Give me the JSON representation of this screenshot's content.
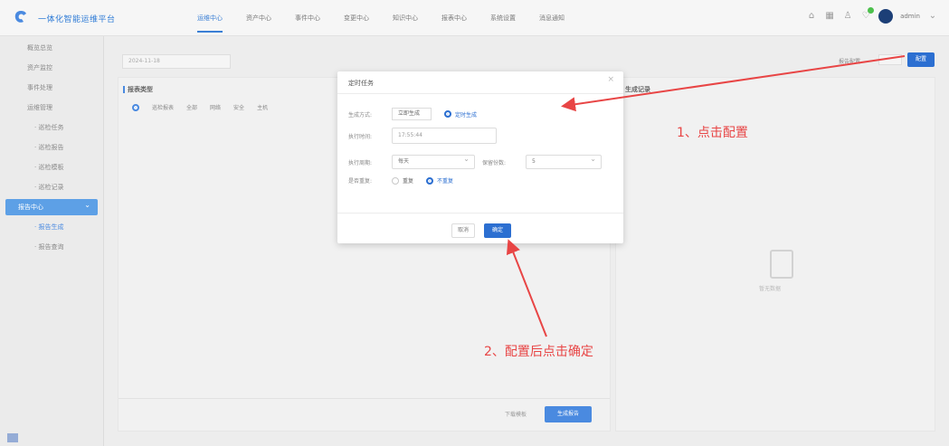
{
  "app": {
    "title": "一体化智能运维平台"
  },
  "nav": {
    "items": [
      "运维中心",
      "资产中心",
      "事件中心",
      "变更中心",
      "知识中心",
      "报表中心",
      "系统设置",
      "消息通知"
    ],
    "active_index": 0
  },
  "header": {
    "user_name": "admin"
  },
  "sidebar": {
    "items": [
      {
        "label": "概览总览",
        "kind": "item"
      },
      {
        "label": "资产监控",
        "kind": "item"
      },
      {
        "label": "事件处理",
        "kind": "item"
      },
      {
        "label": "运维管理",
        "kind": "item"
      },
      {
        "label": "· 巡检任务",
        "kind": "sub"
      },
      {
        "label": "· 巡检报告",
        "kind": "sub"
      },
      {
        "label": "· 巡检模板",
        "kind": "sub"
      },
      {
        "label": "· 巡检记录",
        "kind": "sub"
      },
      {
        "label": "报告中心",
        "kind": "active"
      },
      {
        "label": "· 报告生成",
        "kind": "sub-blue"
      },
      {
        "label": "· 报告查询",
        "kind": "sub"
      }
    ]
  },
  "main": {
    "date_value": "2024-11-18",
    "left_panel": {
      "title": "报表类型",
      "radio_group_label": "巡检报表",
      "options": [
        "全部",
        "网络",
        "安全",
        "主机"
      ],
      "download_label": "下载模板",
      "generate_button": "生成报告"
    },
    "right_panel": {
      "title": "生成记录",
      "empty_text": "暂无数据"
    },
    "config_label": "报告配置",
    "config_button": "配置"
  },
  "modal": {
    "title": "定时任务",
    "close_icon": "close-icon",
    "method_label": "生成方式:",
    "method_options": [
      {
        "label": "立即生成",
        "selected": false
      },
      {
        "label": "定时生成",
        "selected": true
      }
    ],
    "time_label": "执行时间:",
    "time_value": "17:55:44",
    "cycle_label": "执行周期:",
    "cycle_value": "每天",
    "retain_label": "保留份数:",
    "retain_value": "5",
    "repeat_label": "是否重复:",
    "repeat_options": [
      {
        "label": "重复",
        "selected": false
      },
      {
        "label": "不重复",
        "selected": true
      }
    ],
    "cancel_label": "取消",
    "ok_label": "确定"
  },
  "annotations": {
    "step1": "1、点击配置",
    "step2": "2、配置后点击确定",
    "color": "#e84545"
  },
  "colors": {
    "accent": "#2c6fd1",
    "sidebar_active": "#5da0e6",
    "annotation": "#e84545"
  }
}
